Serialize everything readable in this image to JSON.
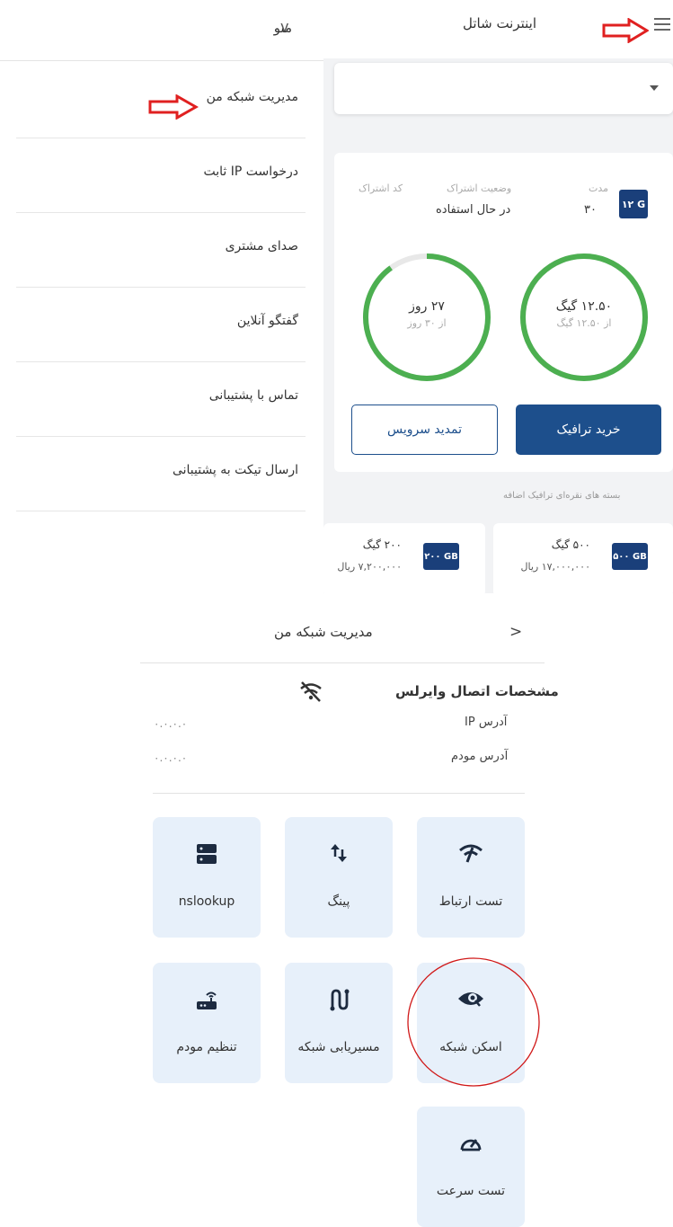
{
  "menu": {
    "title": "منو",
    "chevron": "v",
    "items": [
      {
        "label": "مدیریت شبکه من"
      },
      {
        "label": "درخواست IP ثابت"
      },
      {
        "label": "صدای مشتری"
      },
      {
        "label": "گفتگو آنلاین"
      },
      {
        "label": "تماس با پشتیبانی"
      },
      {
        "label": "ارسال تیکت به پشتیبانی"
      }
    ]
  },
  "app": {
    "title": "اینترنت شاتل",
    "menu_icon": "hamburger-icon"
  },
  "subscription": {
    "badge": "۱۲ G",
    "duration_label": "مدت",
    "duration_value": "۳۰",
    "status_label": "وضعیت اشتراک",
    "status_value": "در حال استفاده",
    "code_label": "کد اشتراک",
    "traffic_main": "۱۲.۵۰ گیگ",
    "traffic_sub": "از ۱۲.۵۰ گیگ",
    "days_main": "۲۷ روز",
    "days_sub": "از ۳۰ روز",
    "traffic_fraction": 1.0,
    "days_fraction": 0.9,
    "buy_traffic": "خرید ترافیک",
    "renew": "تمدید سرویس"
  },
  "extra": {
    "caption": "بسته های نقره‌ای ترافیک اضافه",
    "packages": [
      {
        "badge": "۵۰۰ GB",
        "name": "۵۰۰ گیگ",
        "price": "۱۷,۰۰۰,۰۰۰ ریال"
      },
      {
        "badge": "۲۰۰ GB",
        "name": "۲۰۰ گیگ",
        "price": "۷,۲۰۰,۰۰۰ ریال"
      }
    ]
  },
  "network": {
    "title": "مدیریت شبکه من",
    "back_icon": "chevron-right-icon",
    "wifi_title": "مشخصات اتصال وایرلس",
    "ip_label": "آدرس IP",
    "ip_value": "۰.۰.۰.۰",
    "modem_label": "آدرس مودم",
    "modem_value": "۰.۰.۰.۰",
    "tools": [
      {
        "label": "تست ارتباط",
        "icon": "wifi-signal-icon"
      },
      {
        "label": "پینگ",
        "icon": "up-down-arrows-icon"
      },
      {
        "label": "nslookup",
        "icon": "server-icon"
      },
      {
        "label": "اسکن شبکه",
        "icon": "eye-scan-icon"
      },
      {
        "label": "مسیریابی شبکه",
        "icon": "route-icon"
      },
      {
        "label": "تنظیم مودم",
        "icon": "router-icon"
      },
      {
        "label": "تست سرعت",
        "icon": "speedometer-icon"
      }
    ]
  },
  "colors": {
    "primary": "#1d4f8c",
    "ring": "#4caf50",
    "tile_bg": "#e7f0fa",
    "annotation": "#e02020"
  }
}
